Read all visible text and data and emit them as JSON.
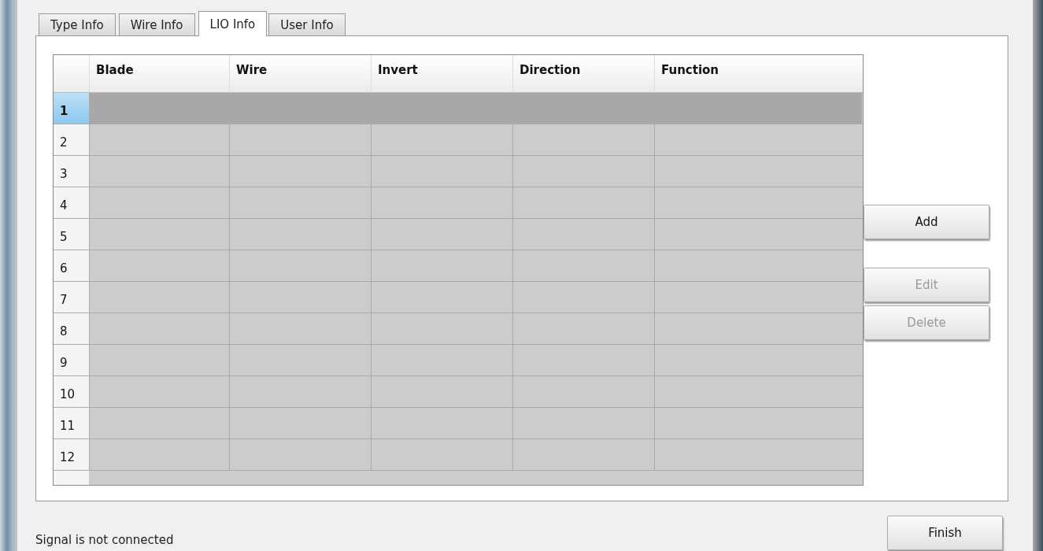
{
  "tabs": [
    {
      "label": "Type Info",
      "selected": false
    },
    {
      "label": "Wire Info",
      "selected": false
    },
    {
      "label": "LIO Info",
      "selected": true
    },
    {
      "label": "User Info",
      "selected": false
    }
  ],
  "table": {
    "columns": [
      "Blade",
      "Wire",
      "Invert",
      "Direction",
      "Function"
    ],
    "rows": [
      {
        "number": "1",
        "selected": true
      },
      {
        "number": "2",
        "selected": false
      },
      {
        "number": "3",
        "selected": false
      },
      {
        "number": "4",
        "selected": false
      },
      {
        "number": "5",
        "selected": false
      },
      {
        "number": "6",
        "selected": false
      },
      {
        "number": "7",
        "selected": false
      },
      {
        "number": "8",
        "selected": false
      },
      {
        "number": "9",
        "selected": false
      },
      {
        "number": "10",
        "selected": false
      },
      {
        "number": "11",
        "selected": false
      },
      {
        "number": "12",
        "selected": false
      }
    ]
  },
  "buttons": [
    {
      "label": "Add",
      "disabled": false
    },
    {
      "label": "Edit",
      "disabled": true
    },
    {
      "label": "Delete",
      "disabled": true
    }
  ],
  "status_bar": {
    "message": "Signal is not connected",
    "button": "Finish"
  }
}
